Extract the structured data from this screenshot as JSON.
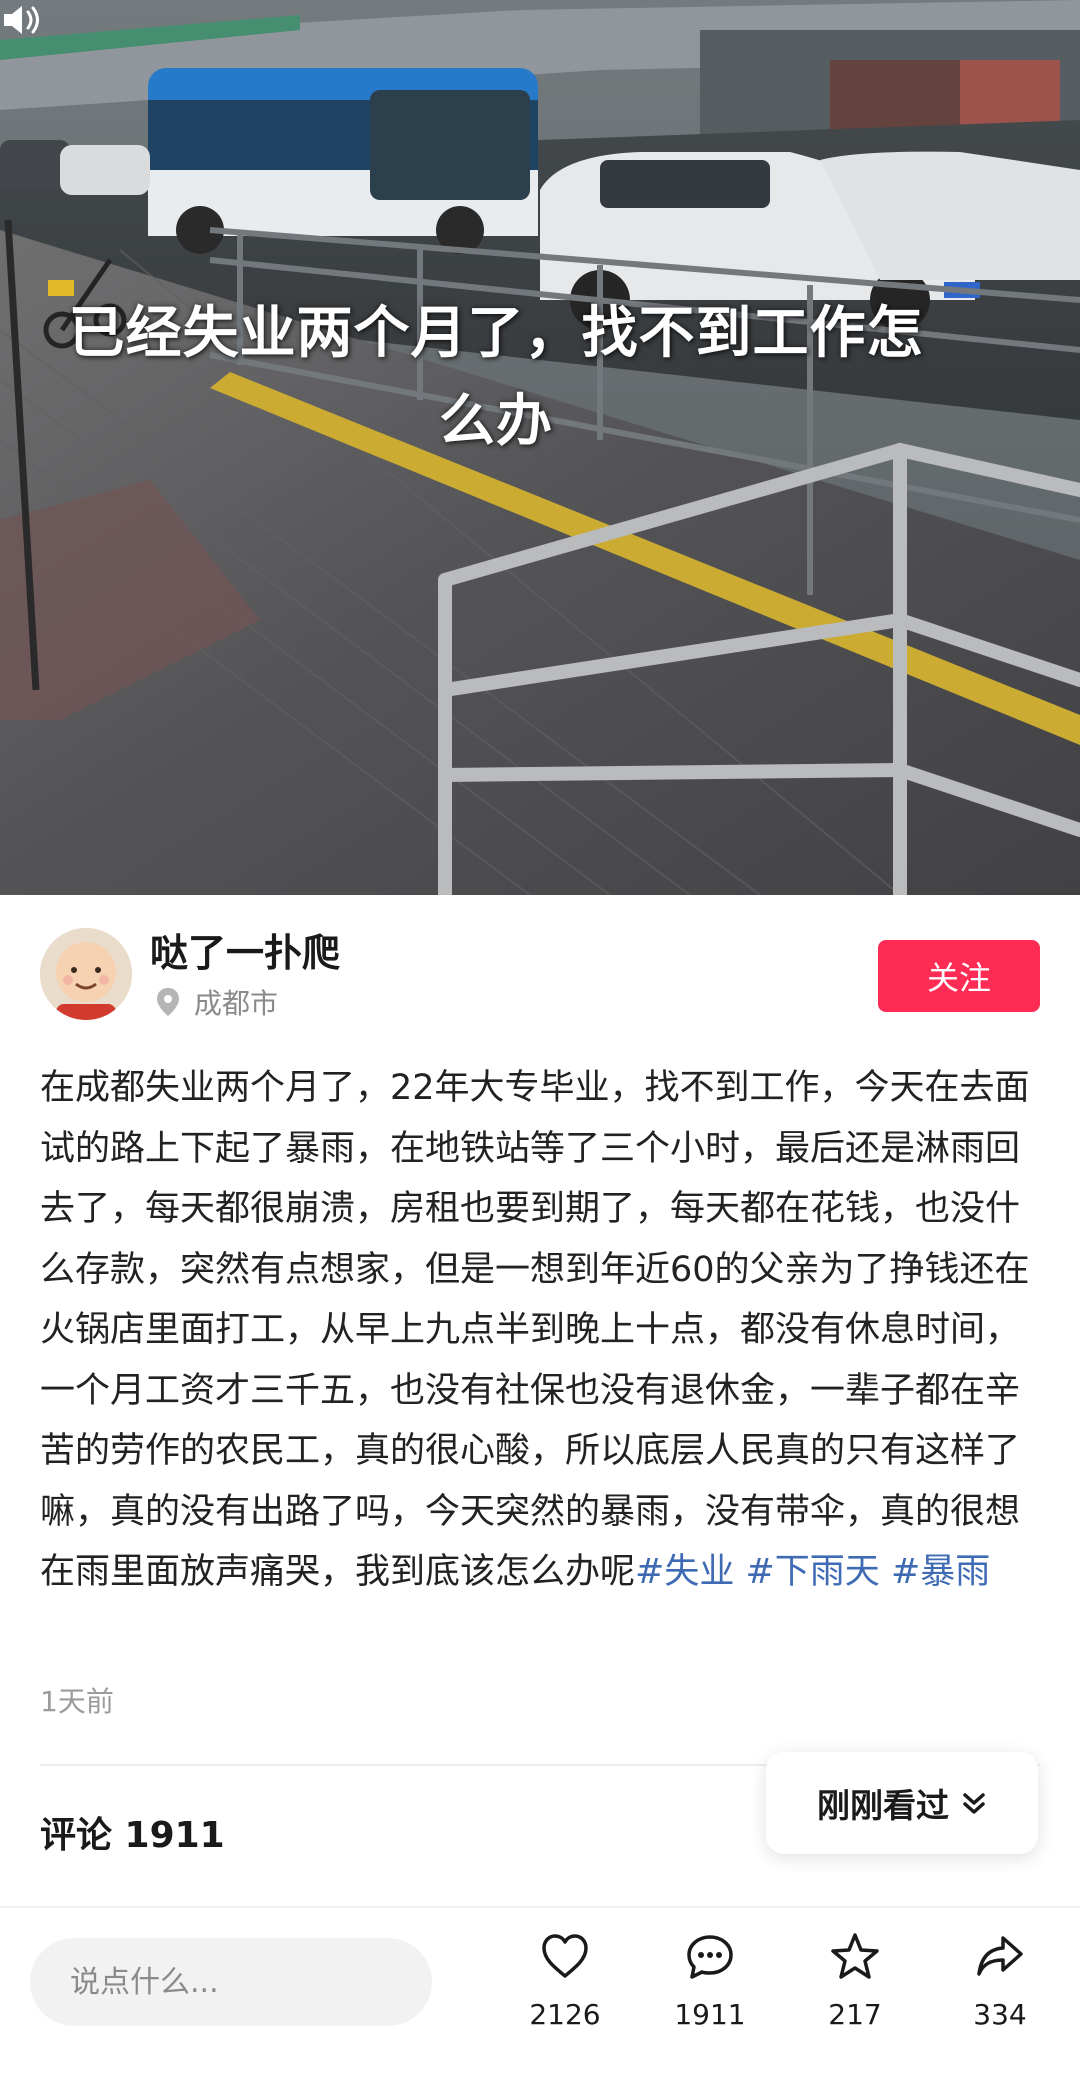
{
  "media": {
    "overlay_title": "已经失业两个月了，找不到工作怎么办",
    "sound_icon": "speaker-icon"
  },
  "author": {
    "name": "哒了一扑爬",
    "location": "成都市",
    "follow_label": "关注",
    "avatar_icon": "avatar-cartoon-icon"
  },
  "post": {
    "text": "在成都失业两个月了，22年大专毕业，找不到工作，今天在去面试的路上下起了暴雨，在地铁站等了三个小时，最后还是淋雨回去了，每天都很崩溃，房租也要到期了，每天都在花钱，也没什么存款，突然有点想家，但是一想到年近60的父亲为了挣钱还在火锅店里面打工，从早上九点半到晚上十点，都没有休息时间，一个月工资才三千五，也没有社保也没有退休金，一辈子都在辛苦的劳作的农民工，真的很心酸，所以底层人民真的只有这样了嘛，真的没有出路了吗，今天突然的暴雨，没有带伞，真的很想在雨里面放声痛哭，我到底该怎么办呢",
    "tags": [
      "#失业",
      "#下雨天",
      "#暴雨"
    ],
    "time": "1天前"
  },
  "comments": {
    "label": "评论 1911",
    "recent_label": "刚刚看过"
  },
  "bottom_bar": {
    "input_placeholder": "说点什么...",
    "likes": "2126",
    "comments": "1911",
    "favorites": "217",
    "shares": "334"
  },
  "colors": {
    "accent": "#fe2c55",
    "tag": "#3f6bb5",
    "muted": "#8a8a8a"
  }
}
